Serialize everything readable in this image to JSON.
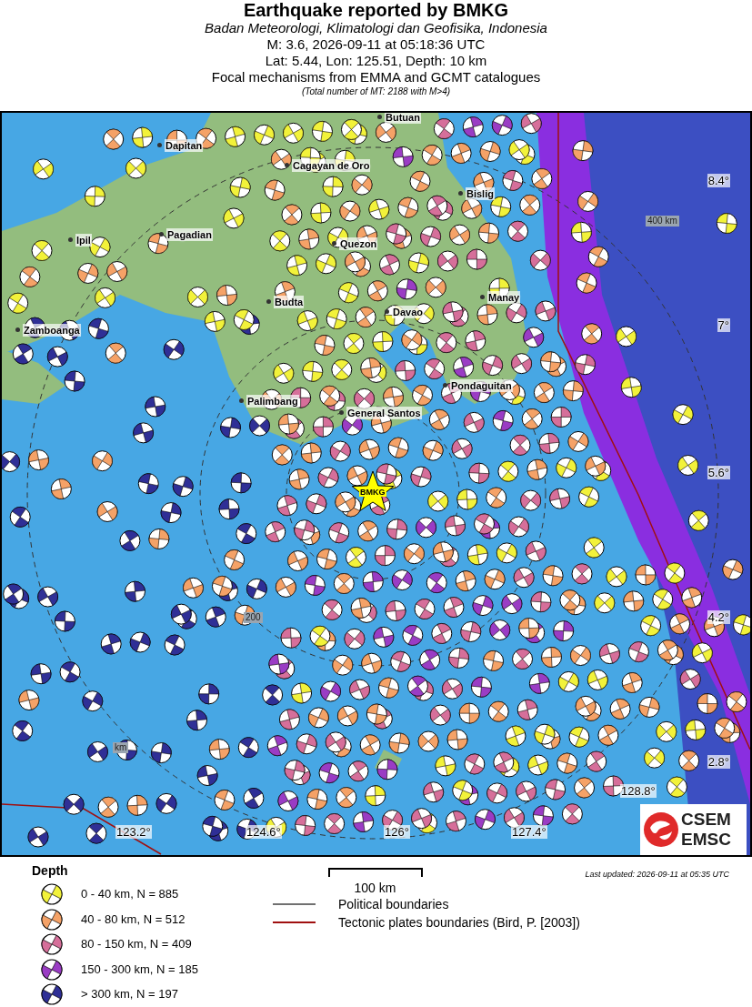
{
  "header": {
    "title": "Earthquake reported by BMKG",
    "agency": "Badan Meteorologi, Klimatologi dan Geofisika, Indonesia",
    "event": "M: 3.6,  2026-09-11 at 05:18:36 UTC",
    "location": "Lat: 5.44, Lon: 125.51, Depth: 10 km",
    "source": "Focal mechanisms from EMMA and GCMT catalogues",
    "total": "(Total number of MT: 2188 with M>4)"
  },
  "map": {
    "cities": [
      {
        "name": "Butuan"
      },
      {
        "name": "Dapitan"
      },
      {
        "name": "Cagayan de Oro"
      },
      {
        "name": "Bislig"
      },
      {
        "name": "Pagadian"
      },
      {
        "name": "Ipil"
      },
      {
        "name": "Quezon"
      },
      {
        "name": "Budta"
      },
      {
        "name": "Manay"
      },
      {
        "name": "Davao"
      },
      {
        "name": "Zamboanga"
      },
      {
        "name": "Pondaguitan"
      },
      {
        "name": "Palimbang"
      },
      {
        "name": "General Santos"
      }
    ],
    "epicenter_label": "BMKG",
    "latitude_labels": [
      "8.4°",
      "7°",
      "5.6°",
      "4.2°",
      "2.8°"
    ],
    "longitude_labels": [
      "123.2°",
      "124.6°",
      "126°",
      "127.4°",
      "128.8°"
    ],
    "distance_labels": [
      "400 km",
      "200",
      "km"
    ],
    "logo": {
      "top": "CSEM",
      "bottom": "EMSC"
    }
  },
  "legend": {
    "heading": "Depth",
    "depth_classes": [
      {
        "label": "0 - 40 km, N = 885",
        "color": "#f2f23a"
      },
      {
        "label": "40 - 80 km, N = 512",
        "color": "#f5a267"
      },
      {
        "label": "80 - 150 km, N = 409",
        "color": "#d66f9a"
      },
      {
        "label": "150 - 300 km, N = 185",
        "color": "#9a3cc4"
      },
      {
        "label": "> 300 km, N = 197",
        "color": "#2f2f96"
      }
    ],
    "scale_label": "100 km",
    "lines": [
      {
        "label": "Political boundaries",
        "color": "#707070"
      },
      {
        "label": "Tectonic plates boundaries (Bird, P. [2003])",
        "color": "#a01010"
      }
    ],
    "last_updated": "Last updated: 2026-09-11 at 05:35 UTC"
  }
}
